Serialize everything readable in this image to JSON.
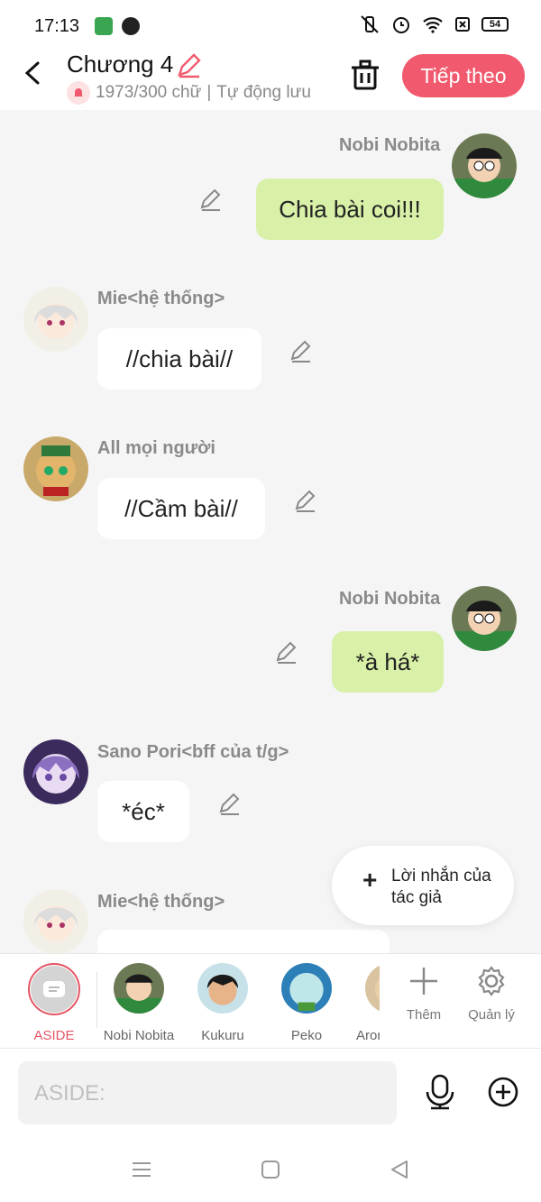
{
  "status": {
    "time": "17:13",
    "battery": "54"
  },
  "header": {
    "title": "Chương 4",
    "word_count": "1973/300 chữ",
    "separator": "|",
    "autosave": "Tự động lưu",
    "next_label": "Tiếp theo"
  },
  "messages": [
    {
      "sender": "Nobi Nobita",
      "text": "Chia bài coi!!!",
      "side": "right"
    },
    {
      "sender": "Mie<hệ thống>",
      "text": "//chia bài//",
      "side": "left"
    },
    {
      "sender": "All mọi người",
      "text": "//Cầm bài//",
      "side": "left"
    },
    {
      "sender": "Nobi Nobita",
      "text": "*à há*",
      "side": "right"
    },
    {
      "sender": "Sano Pori<bff của t/g>",
      "text": "*éc*",
      "side": "left"
    },
    {
      "sender": "Mie<hệ thống>",
      "text": "",
      "side": "left"
    }
  ],
  "author_note": {
    "label": "Lời nhắn của tác giả"
  },
  "characters": [
    {
      "label": "ASIDE"
    },
    {
      "label": "Nobi Nobita"
    },
    {
      "label": "Kukuru"
    },
    {
      "label": "Peko"
    },
    {
      "label": "Aron"
    }
  ],
  "tools": {
    "add_label": "Thêm",
    "manage_label": "Quản lý"
  },
  "input": {
    "placeholder": "ASIDE:"
  },
  "colors": {
    "accent": "#f15a6e",
    "my_bubble": "#d8f0a7",
    "their_bubble": "#ffffff"
  }
}
